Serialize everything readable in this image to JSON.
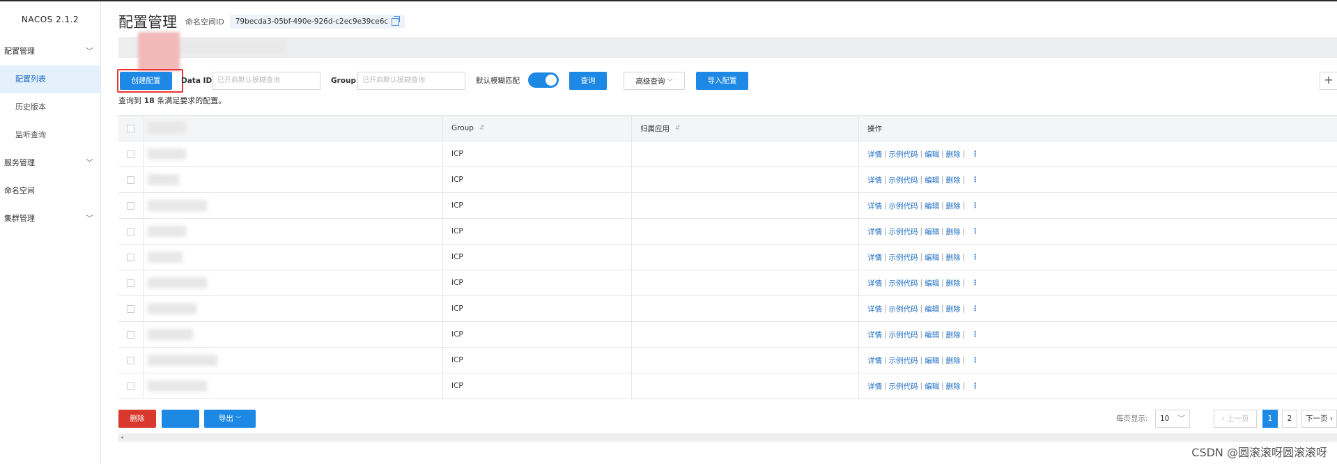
{
  "app": {
    "logo": "NACOS 2.1.2"
  },
  "sidebar": {
    "items": [
      {
        "label": "配置管理",
        "expandable": true
      },
      {
        "label": "配置列表",
        "sub": true,
        "active": true
      },
      {
        "label": "历史版本",
        "sub": true
      },
      {
        "label": "监听查询",
        "sub": true
      },
      {
        "label": "服务管理",
        "expandable": true
      },
      {
        "label": "命名空间"
      },
      {
        "label": "集群管理",
        "expandable": true
      }
    ]
  },
  "header": {
    "title": "配置管理",
    "namespace_label": "命名空间ID",
    "namespace_id": "79becda3-05bf-490e-926d-c2ec9e39ce6c"
  },
  "toolbar": {
    "create_label": "创建配置",
    "dataid_label": "Data ID",
    "dataid_placeholder": "已开启默认模糊查询",
    "group_label": "Group",
    "group_placeholder": "已开启默认模糊查询",
    "fuzzy_label": "默认模糊匹配",
    "query_label": "查询",
    "advanced_label": "高级查询",
    "import_label": "导入配置",
    "plus": "+"
  },
  "result": {
    "prefix": "查询到",
    "count": "18",
    "suffix": "条满足要求的配置。"
  },
  "table": {
    "headers": {
      "group": "Group",
      "app": "归属应用",
      "ops": "操作"
    },
    "rows": [
      {
        "group": "ICP"
      },
      {
        "group": "ICP"
      },
      {
        "group": "ICP"
      },
      {
        "group": "ICP"
      },
      {
        "group": "ICP"
      },
      {
        "group": "ICP"
      },
      {
        "group": "ICP"
      },
      {
        "group": "ICP"
      },
      {
        "group": "ICP"
      },
      {
        "group": "ICP"
      }
    ],
    "ops": {
      "detail": "详情",
      "sample": "示例代码",
      "edit": "编辑",
      "delete": "删除",
      "sep": "|",
      "more": "⋮"
    }
  },
  "bottom": {
    "delete_label": "删除",
    "export_label": "导出",
    "page_size_label": "每页显示:",
    "page_size": "10",
    "prev_label": "上一页",
    "pages": [
      "1",
      "2"
    ],
    "next_label": "下一页"
  },
  "watermark": "CSDN @圆滚滚呀圆滚滚呀"
}
